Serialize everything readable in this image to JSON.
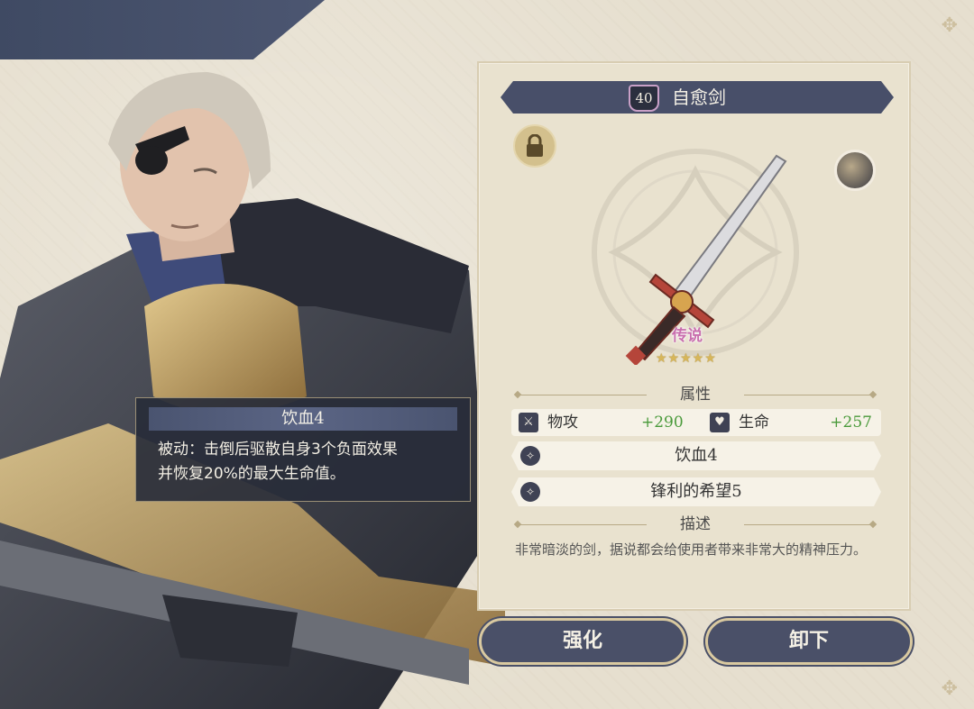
{
  "tooltip": {
    "title": "饮血4",
    "line1": "被动：击倒后驱散自身3个负面效果",
    "line2": "并恢复20%的最大生命值。"
  },
  "item": {
    "level": "40",
    "name": "自愈剑",
    "rarity": "传说",
    "stars": "★★★★★",
    "star_count": 5
  },
  "attributes": {
    "header": "属性",
    "stats": [
      {
        "icon": "sword-icon",
        "label": "物攻",
        "value": "+290"
      },
      {
        "icon": "heart-icon",
        "label": "生命",
        "value": "+257"
      }
    ],
    "skills": [
      {
        "icon": "skill-icon",
        "name": "饮血4"
      },
      {
        "icon": "skill-icon",
        "name": "锋利的希望5"
      }
    ]
  },
  "description": {
    "header": "描述",
    "text": "非常暗淡的剑，据说都会给使用者带来非常大的精神压力。"
  },
  "actions": {
    "enhance": "强化",
    "unequip": "卸下"
  },
  "colors": {
    "panel_bg": "#e9e2cf",
    "title_bar": "#484f69",
    "stat_value": "#4a9a3b",
    "button_bg": "#4a5068",
    "rarity": "#c96fae"
  }
}
